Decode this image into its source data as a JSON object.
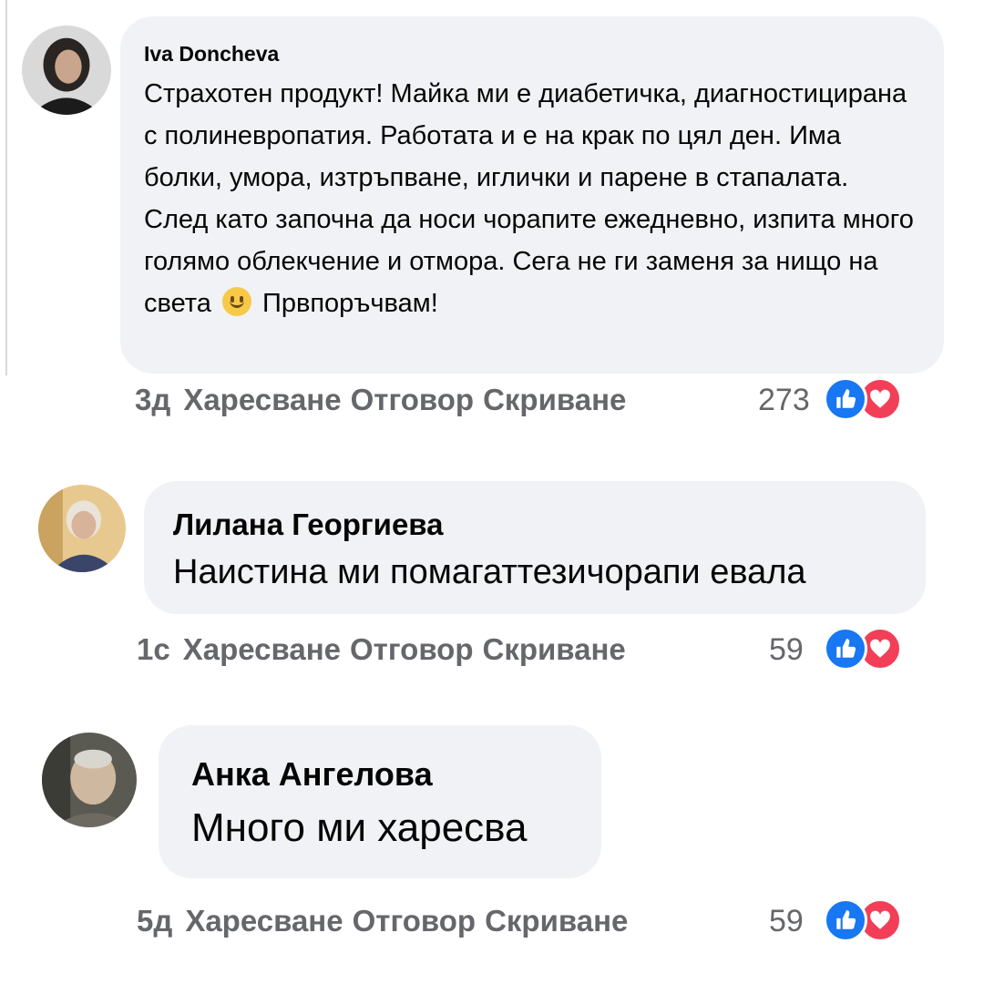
{
  "comments": [
    {
      "author": "Iva Doncheva",
      "text": "Страхотен продукт! Майка ми е диабетичка, диагностицирана с полиневропатия. Работата и е на крак по цял ден. Има болки, умора, изтръпване, иглички и парене в стапалата. След като започна да носи чорапите ежедневно, изпита много голямо облекчение и отмора. Сега не ги заменя за нищо на света",
      "emoji": "slightly-smiling-face-icon",
      "text_after_emoji": "Првпоръчвам!",
      "time": "3д",
      "like_label": "Харесване",
      "reply_label": "Отговор",
      "hide_label": "Скриване",
      "reaction_count": "273",
      "reactions": [
        "like-icon",
        "love-icon"
      ]
    },
    {
      "author": "Лилана Георгиева",
      "text": "Наистина ми помагаттезичорапи евала",
      "time": "1с",
      "like_label": "Харесване",
      "reply_label": "Отговор",
      "hide_label": "Скриване",
      "reaction_count": "59",
      "reactions": [
        "like-icon",
        "love-icon"
      ]
    },
    {
      "author": "Анка Ангелова",
      "text": "Много ми харесва",
      "time": "5д",
      "like_label": "Харесване",
      "reply_label": "Отговор",
      "hide_label": "Скриване",
      "reaction_count": "59",
      "reactions": [
        "like-icon",
        "love-icon"
      ]
    }
  ],
  "colors": {
    "bubble": "#f0f2f5",
    "meta_text": "#65676b",
    "like": "#1877f2",
    "love": "#f33e58",
    "emoji": "#f7c948"
  }
}
